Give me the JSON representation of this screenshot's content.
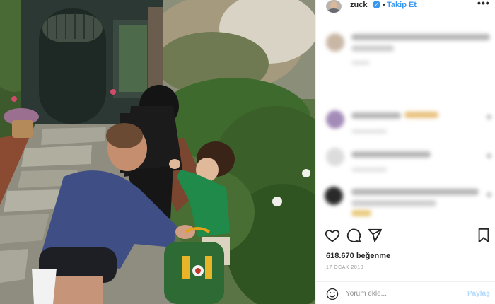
{
  "post": {
    "username": "zuck",
    "verified_icon": "verified-badge-icon",
    "separator": "•",
    "follow_label": "Takip Et",
    "more_label": "•••",
    "likes": "618.670 beğenme",
    "date": "17 OCAK 2018",
    "comment_placeholder": "Yorum ekle...",
    "share_label": "Paylaş"
  },
  "icons": {
    "like": "heart-icon",
    "comment": "comment-icon",
    "share": "send-icon",
    "save": "bookmark-icon",
    "emoji": "smile-icon"
  },
  "colors": {
    "link_blue": "#3897f0",
    "share_disabled": "#b3dbff",
    "muted_text": "#999999",
    "border": "#efefef"
  }
}
